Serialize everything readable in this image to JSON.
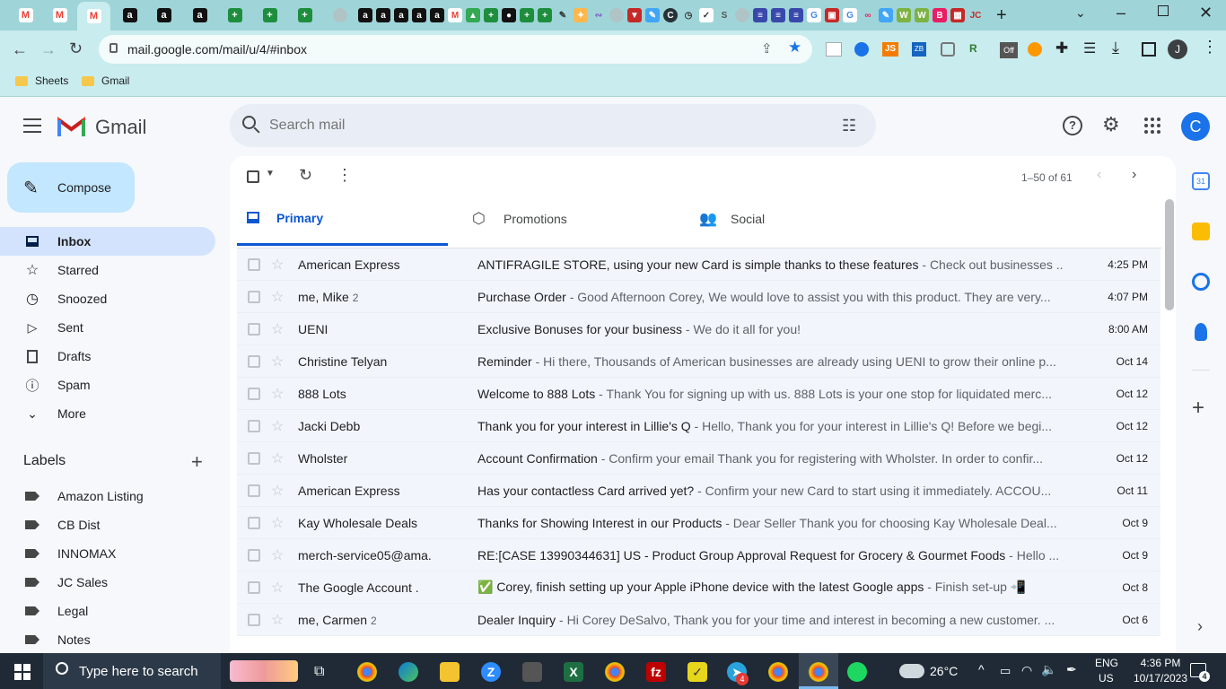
{
  "browser": {
    "url": "mail.google.com/mail/u/4/#inbox",
    "bookmarks": [
      "Sheets",
      "Gmail"
    ],
    "profile_initial": "J",
    "new_tab_label": "+"
  },
  "gmail": {
    "logo_text": "Gmail",
    "search_placeholder": "Search mail",
    "compose_label": "Compose",
    "avatar_initial": "C",
    "nav": [
      {
        "label": "Inbox",
        "icon": "inbox-icon"
      },
      {
        "label": "Starred",
        "icon": "star-icon"
      },
      {
        "label": "Snoozed",
        "icon": "clock-icon"
      },
      {
        "label": "Sent",
        "icon": "send-icon"
      },
      {
        "label": "Drafts",
        "icon": "draft-icon"
      },
      {
        "label": "Spam",
        "icon": "spam-icon"
      },
      {
        "label": "More",
        "icon": "chevron-down-icon"
      }
    ],
    "labels_heading": "Labels",
    "labels": [
      "Amazon Listing",
      "CB Dist",
      "INNOMAX",
      "JC Sales",
      "Legal",
      "Notes"
    ],
    "pagination": "1–50 of 61",
    "tabs": [
      {
        "label": "Primary"
      },
      {
        "label": "Promotions"
      },
      {
        "label": "Social"
      }
    ],
    "emails": [
      {
        "sender": "American Express",
        "count": "",
        "subject": "ANTIFRAGILE STORE, using your new Card is simple thanks to these features",
        "snippet": " - Check out businesses ...",
        "date": "4:25 PM"
      },
      {
        "sender": "me, Mike",
        "count": "2",
        "subject": "Purchase Order",
        "snippet": " - Good Afternoon Corey, We would love to assist you with this product. They are very...",
        "date": "4:07 PM"
      },
      {
        "sender": "UENI",
        "count": "",
        "subject": "Exclusive Bonuses for your business",
        "snippet": " - We do it all for you!",
        "date": "8:00 AM"
      },
      {
        "sender": "Christine Telyan",
        "count": "",
        "subject": "Reminder",
        "snippet": " - Hi there, Thousands of American businesses are already using UENI to grow their online p...",
        "date": "Oct 14"
      },
      {
        "sender": "888 Lots",
        "count": "",
        "subject": "Welcome to 888 Lots",
        "snippet": " - Thank You for signing up with us. 888 Lots is your one stop for liquidated merc...",
        "date": "Oct 12"
      },
      {
        "sender": "Jacki Debb",
        "count": "",
        "subject": "Thank you for your interest in Lillie's Q",
        "snippet": " - Hello, Thank you for your interest in Lillie's Q! Before we begi...",
        "date": "Oct 12"
      },
      {
        "sender": "Wholster",
        "count": "",
        "subject": "Account Confirmation",
        "snippet": " - Confirm your email Thank you for registering with Wholster. In order to confir...",
        "date": "Oct 12"
      },
      {
        "sender": "American Express",
        "count": "",
        "subject": "Has your contactless Card arrived yet?",
        "snippet": " - Confirm your new Card to start using it immediately. ACCOU...",
        "date": "Oct 11"
      },
      {
        "sender": "Kay Wholesale Deals",
        "count": "",
        "subject": "Thanks for Showing Interest in our Products",
        "snippet": " - Dear Seller Thank you for choosing Kay Wholesale Deal...",
        "date": "Oct 9"
      },
      {
        "sender": "merch-service05@ama.",
        "count": "",
        "subject": "RE:[CASE 13990344631] US - Product Group Approval Request for Grocery & Gourmet Foods",
        "snippet": " - Hello ...",
        "date": "Oct 9"
      },
      {
        "sender": "The Google Account .",
        "count": "",
        "subject": "✅ Corey, finish setting up your Apple iPhone device with the latest Google apps",
        "snippet": " - Finish set-up 📲",
        "date": "Oct 8"
      },
      {
        "sender": "me, Carmen",
        "count": "2",
        "subject": "Dealer Inquiry",
        "snippet": " - Hi Corey DeSalvo, Thank you for your time and interest in becoming a new customer. ...",
        "date": "Oct 6"
      }
    ]
  },
  "taskbar": {
    "search_placeholder": "Type here to search",
    "weather": "26°C",
    "lang_top": "ENG",
    "lang_bottom": "US",
    "time": "4:36 PM",
    "date": "10/17/2023",
    "notifications": "4",
    "telegram_badge": "4"
  },
  "colors": {
    "chrome_tab_bar": "#9fd5d8",
    "chrome_toolbar": "#c9ecee",
    "gmail_selected_nav": "#d3e3fd",
    "compose_bg": "#c2e7ff",
    "primary_blue": "#0b57d0",
    "taskbar": "#1f2a36"
  }
}
